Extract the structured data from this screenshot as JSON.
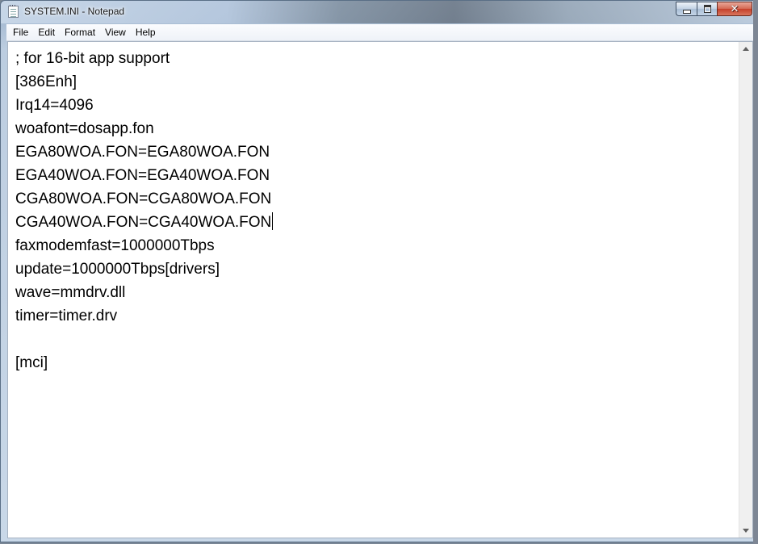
{
  "window": {
    "title": "SYSTEM.INI - Notepad"
  },
  "menu": [
    "File",
    "Edit",
    "Format",
    "View",
    "Help"
  ],
  "document": {
    "lines": [
      "; for 16-bit app support",
      "[386Enh]",
      "Irq14=4096",
      "woafont=dosapp.fon",
      "EGA80WOA.FON=EGA80WOA.FON",
      "EGA40WOA.FON=EGA40WOA.FON",
      "CGA80WOA.FON=CGA80WOA.FON",
      "CGA40WOA.FON=CGA40WOA.FON",
      "faxmodemfast=1000000Tbps",
      "update=1000000Tbps[drivers]",
      "wave=mmdrv.dll",
      "timer=timer.drv",
      "",
      "[mci]"
    ],
    "caret_line": 7
  },
  "icons": {
    "app": "notepad-icon",
    "minimize": "minimize-icon",
    "maximize": "maximize-icon",
    "close": "close-icon"
  }
}
